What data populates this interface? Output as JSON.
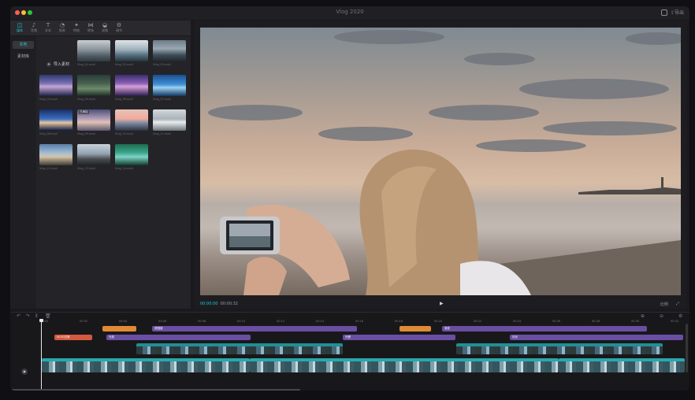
{
  "window": {
    "title": "Vlog 2020",
    "title_right": "导出",
    "traffic_lights": [
      "#ff5f57",
      "#febc2e",
      "#28c840"
    ]
  },
  "toolbar": {
    "items": [
      {
        "icon": "media-icon",
        "glyph": "◫",
        "label": "媒体",
        "active": true
      },
      {
        "icon": "audio-icon",
        "glyph": "♪",
        "label": "音频",
        "active": false
      },
      {
        "icon": "text-icon",
        "glyph": "T",
        "label": "文本",
        "active": false
      },
      {
        "icon": "sticker-icon",
        "glyph": "◔",
        "label": "贴纸",
        "active": false
      },
      {
        "icon": "effects-icon",
        "glyph": "✦",
        "label": "特效",
        "active": false
      },
      {
        "icon": "transition-icon",
        "glyph": "⋈",
        "label": "转场",
        "active": false
      },
      {
        "icon": "filter-icon",
        "glyph": "◒",
        "label": "滤镜",
        "active": false
      },
      {
        "icon": "adjust-icon",
        "glyph": "⚙",
        "label": "调节",
        "active": false
      }
    ]
  },
  "subnav": {
    "items": [
      {
        "label": "本地",
        "active": true
      },
      {
        "label": "素材库",
        "active": false
      }
    ]
  },
  "media": {
    "import_label": "导入素材",
    "thumbs": [
      {
        "caption": "Vlog_01.mp4",
        "grad": "linear-gradient(180deg,#c9cfd4,#8a939a 45%,#4e5a63 75%,#2f3a40)",
        "badge": ""
      },
      {
        "caption": "Vlog_02.mp4",
        "grad": "linear-gradient(180deg,#dfe4e8,#9fb0bc 45%,#55707f 70%,#26343c)",
        "badge": ""
      },
      {
        "caption": "Vlog_03.mp4",
        "grad": "linear-gradient(180deg,#6d7b88,#9aa8b3 40%,#3e4c57 70%,#20272d)",
        "badge": ""
      },
      {
        "caption": "Vlog_04.mp4",
        "grad": "linear-gradient(180deg,#2c3a6e,#7a6fb5 40%,#c6a7d6 55%,#1c2244)",
        "badge": ""
      },
      {
        "caption": "Vlog_05.mp4",
        "grad": "linear-gradient(180deg,#2a3d3a,#47604f 40%,#6e8c6a 65%,#1e2a26)",
        "badge": ""
      },
      {
        "caption": "Vlog_06.mp4",
        "grad": "linear-gradient(180deg,#3b2f6e,#8a5fb7 40%,#d7a1d8 55%,#281c4a)",
        "badge": ""
      },
      {
        "caption": "Vlog_07.mp4",
        "grad": "linear-gradient(180deg,#1b4e8f,#3f8fd6 45%,#9cd0ef 60%,#123660)",
        "badge": ""
      },
      {
        "caption": "Vlog_08.mp4",
        "grad": "linear-gradient(180deg,#1a2e66,#3a6fc1 45%,#e6c6a1 62%,#0d1a3c)",
        "badge": ""
      },
      {
        "caption": "Vlog_09.mp4",
        "grad": "linear-gradient(180deg,#4a4f78,#b7a1b8 45%,#e3c2b4 60%,#5a5670)",
        "badge": "已添加"
      },
      {
        "caption": "Vlog_10.mp4",
        "grad": "linear-gradient(180deg,#e6c3b9,#f1a99b 45%,#7f8fa6 62%,#2e3140)",
        "badge": ""
      },
      {
        "caption": "Vlog_11.mp4",
        "grad": "linear-gradient(180deg,#d3d8dc,#aab3b9 45%,#e9ecee 60%,#6c747a)",
        "badge": ""
      },
      {
        "caption": "Vlog_12.mp4",
        "grad": "linear-gradient(180deg,#5b7ea8,#a9c1d6 45%,#d6c2a4 60%,#3c3a36)",
        "badge": ""
      },
      {
        "caption": "Vlog_13.mp4",
        "grad": "linear-gradient(180deg,#c8d0d6,#93a4b3 45%,#4c4d4f 70%,#1f2326)",
        "badge": ""
      },
      {
        "caption": "Vlog_14.mp4",
        "grad": "linear-gradient(180deg,#1f6b4f,#3aa58b 40%,#7fd4c7 60%,#0f3a2c)",
        "badge": ""
      }
    ]
  },
  "viewer": {
    "current_time": "00:00:00",
    "total_time": "00:00:32",
    "play_glyph": "▶",
    "ratio_label": "比例",
    "fit_label": "适应",
    "fullscreen_glyph": "⤢"
  },
  "timeline": {
    "tool_glyphs": [
      "↶",
      "↷",
      "⫴",
      "🗑"
    ],
    "right_glyphs": [
      "⊕",
      "⊖",
      "⚙"
    ],
    "ruler": [
      "00:00",
      "00:02",
      "00:04",
      "00:06",
      "00:08",
      "00:10",
      "00:12",
      "00:14",
      "00:16",
      "00:18",
      "00:20",
      "00:22",
      "00:24",
      "00:26",
      "00:28",
      "00:30",
      "00:32"
    ],
    "track_effects": [
      {
        "label": "",
        "kind": "filt"
      },
      {
        "label": "氛围感",
        "kind": "fx"
      },
      {
        "label": "",
        "kind": "filt"
      },
      {
        "label": "渐变",
        "kind": "fx"
      }
    ],
    "track_effects2": [
      {
        "label": "VLOG日常",
        "kind": "txt"
      },
      {
        "label": "光斑",
        "kind": "fx"
      },
      {
        "label": "光晕",
        "kind": "fx"
      },
      {
        "label": "闪光",
        "kind": "fx"
      }
    ],
    "pip_clips": [
      {
        "label": "Vlog_05.mp4"
      },
      {
        "label": "Vlog_09.mp4"
      }
    ],
    "main_clips": [
      {
        "label": "Vlog_01.mp4"
      },
      {
        "label": "Vlog_02.mp4"
      },
      {
        "label": "Vlog_03.mp4"
      }
    ],
    "main_icon": "◉"
  }
}
